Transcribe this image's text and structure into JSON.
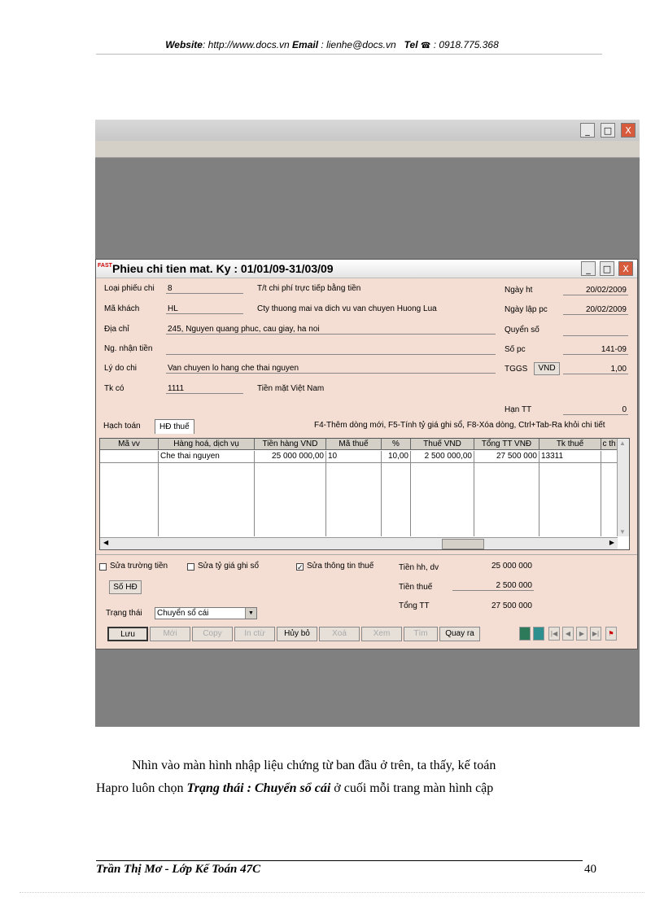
{
  "header": {
    "website_label": "Website",
    "website_value": ": http://www.docs.vn",
    "email_label": "Email",
    "email_value": " : lienhe@docs.vn",
    "tel_label": "Tel",
    "tel_value": " : 0918.775.368"
  },
  "window": {
    "logo": "FAST",
    "title": "Phieu chi tien mat. Ky : 01/01/09-31/03/09",
    "min_btn": "_",
    "max_btn": "□",
    "close_btn": "X"
  },
  "outer_window": {
    "min_btn": "_",
    "max_btn": "□",
    "close_btn": "X"
  },
  "form": {
    "loai_phieu_chi_label": "Loại phiếu chi",
    "loai_phieu_chi_value": "8",
    "loai_phieu_chi_desc": "T/t chi phí trực tiếp bằng tiền",
    "ma_khach_label": "Mã khách",
    "ma_khach_value": "HL",
    "ma_khach_desc": "Cty thuong mai va dich vu van chuyen Huong Lua",
    "dia_chi_label": "Địa chỉ",
    "dia_chi_value": "245, Nguyen quang phuc, cau giay, ha noi",
    "ng_nhan_tien_label": "Ng. nhận tiền",
    "ng_nhan_tien_value": "",
    "ly_do_chi_label": "Lý do chi",
    "ly_do_chi_value": "Van chuyen lo hang che thai nguyen",
    "tk_co_label": "Tk có",
    "tk_co_value": "1111",
    "tk_co_desc": "Tiền mặt Việt Nam",
    "ngay_ht_label": "Ngày ht",
    "ngay_ht_value": "20/02/2009",
    "ngay_lap_pc_label": "Ngày lập pc",
    "ngay_lap_pc_value": "20/02/2009",
    "quyen_so_label": "Quyển số",
    "quyen_so_value": "",
    "so_pc_label": "Số pc",
    "so_pc_value": "141-09",
    "tggs_label": "TGGS",
    "tggs_currency": "VND",
    "tggs_value": "1,00",
    "han_tt_label": "Hạn TT",
    "han_tt_value": "0"
  },
  "tabs": {
    "hach_toan": "Hạch toán",
    "hd_thue": "HĐ thuế",
    "hint": "F4-Thêm dòng mới, F5-Tính tỷ giá ghi sổ, F8-Xóa dòng, Ctrl+Tab-Ra khỏi chi tiết"
  },
  "grid": {
    "headers": [
      "Mã vv",
      "Hàng hoá, dịch vụ",
      "Tiền hàng VND",
      "Mã thuế",
      "%",
      "Thuế VND",
      "Tổng TT VNĐ",
      "Tk thuế",
      "c th"
    ],
    "row": [
      "",
      "Che thai nguyen",
      "25 000 000,00",
      "10",
      "10,00",
      "2 500 000,00",
      "27 500 000",
      "13311",
      ""
    ]
  },
  "bottom": {
    "sua_truong_tien": "Sửa trường tiền",
    "sua_ty_gia": "Sửa tỷ giá ghi sổ",
    "sua_thong_tin_thue": "Sửa thông tin thuế",
    "so_hd_button": "Số HĐ",
    "trang_thai_label": "Trạng thái",
    "trang_thai_value": "Chuyển sổ cái",
    "tien_hh_label": "Tiền hh, dv",
    "tien_hh_value": "25 000 000",
    "tien_thue_label": "Tiền thuế",
    "tien_thue_value": "2 500 000",
    "tong_tt_label": "Tổng TT",
    "tong_tt_value": "27 500 000"
  },
  "buttons": {
    "luu": "Lưu",
    "moi": "Mới",
    "copy": "Copy",
    "in_ctu": "In ctừ",
    "huy_bo": "Hủy bỏ",
    "xoa": "Xoá",
    "xem": "Xem",
    "tim": "Tìm",
    "quay_ra": "Quay ra"
  },
  "body_text": {
    "line1": "Nhìn vào màn hình nhập liệu chứng từ ban đầu ở trên, ta thấy, kế toán",
    "line2_prefix": "Hapro luôn chọn ",
    "line2_emph": "Trạng thái : Chuyển sổ cái",
    "line2_suffix": " ở cuối mỗi trang màn hình cập"
  },
  "footer": {
    "author": "Trần Thị Mơ - Lớp Kế Toán 47C",
    "page_number": "40"
  }
}
